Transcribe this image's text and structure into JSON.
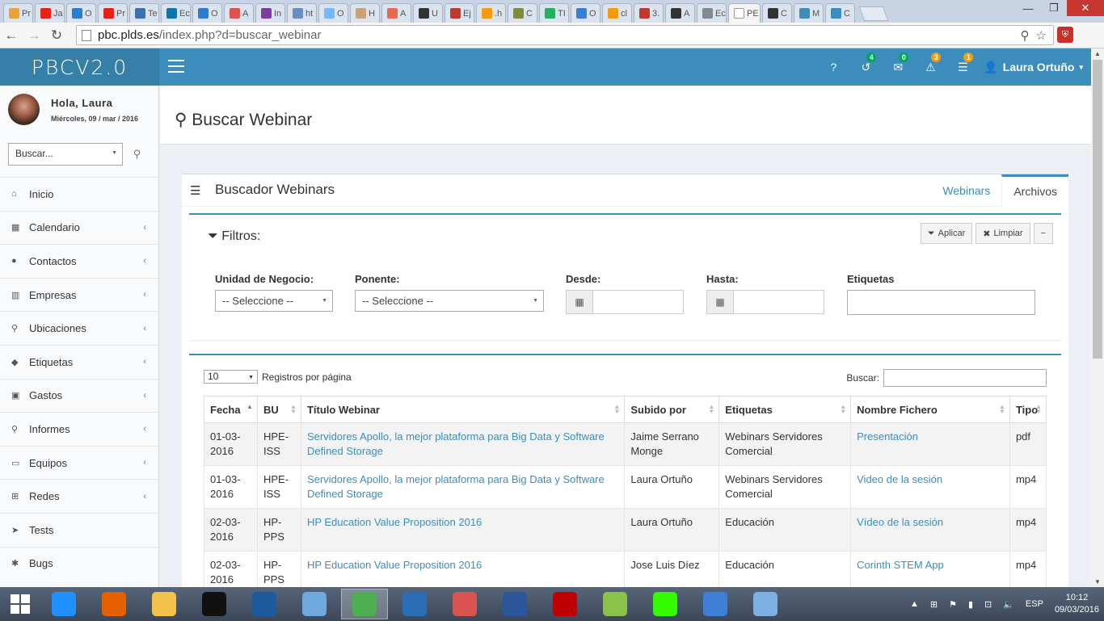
{
  "browser": {
    "tabs": [
      {
        "label": "Pr",
        "color": "#e8a23c"
      },
      {
        "label": "Ja",
        "color": "#e62117"
      },
      {
        "label": "O",
        "color": "#2b7cd3"
      },
      {
        "label": "Pr",
        "color": "#e62117"
      },
      {
        "label": "Te",
        "color": "#3b6fb6"
      },
      {
        "label": "Ec",
        "color": "#0e76a8"
      },
      {
        "label": "O",
        "color": "#2b7cd3"
      },
      {
        "label": "A",
        "color": "#d9534f"
      },
      {
        "label": "In",
        "color": "#7b3e9b"
      },
      {
        "label": "ht",
        "color": "#6c8ebf"
      },
      {
        "label": "O",
        "color": "#74b9ff"
      },
      {
        "label": "H",
        "color": "#c7a27a"
      },
      {
        "label": "A",
        "color": "#e86a4e"
      },
      {
        "label": "U",
        "color": "#333333"
      },
      {
        "label": "Ej",
        "color": "#c0392b"
      },
      {
        "label": ".h",
        "color": "#f39c12"
      },
      {
        "label": "C",
        "color": "#7f8c3c"
      },
      {
        "label": "TI",
        "color": "#27ae60"
      },
      {
        "label": "O",
        "color": "#3b7dd8"
      },
      {
        "label": "cl",
        "color": "#f39c12"
      },
      {
        "label": "3.",
        "color": "#c0392b"
      },
      {
        "label": "A",
        "color": "#333333"
      },
      {
        "label": "Ec",
        "color": "#7f8c8d"
      },
      {
        "label": "PE",
        "color": "#ffffff",
        "active": true
      },
      {
        "label": "C",
        "color": "#333333"
      },
      {
        "label": "M",
        "color": "#3c8dbc"
      },
      {
        "label": "C",
        "color": "#3c8dbc"
      }
    ],
    "url_host": "pbc.plds.es",
    "url_path": "/index.php?d=buscar_webinar"
  },
  "header": {
    "logo": "PBCV2.0",
    "icons": [
      {
        "name": "help-icon",
        "glyph": "?",
        "badge": "",
        "badge_color": ""
      },
      {
        "name": "history-icon",
        "glyph": "↺",
        "badge": "4",
        "badge_color": "#00a65a"
      },
      {
        "name": "mail-icon",
        "glyph": "✉",
        "badge": "0",
        "badge_color": "#00a65a"
      },
      {
        "name": "alert-icon",
        "glyph": "⚠",
        "badge": "3",
        "badge_color": "#f39c12"
      },
      {
        "name": "tasks-icon",
        "glyph": "☰",
        "badge": "1",
        "badge_color": "#f39c12"
      }
    ],
    "user_name": "Laura Ortuño"
  },
  "sidebar": {
    "greeting": "Hola, Laura",
    "date": "Miércoles, 09 / mar / 2016",
    "search_placeholder": "Buscar...",
    "items": [
      {
        "label": "Inicio",
        "icon": "home-icon",
        "glyph": "⌂",
        "chevron": false
      },
      {
        "label": "Calendario",
        "icon": "calendar-icon",
        "glyph": "▦",
        "chevron": true
      },
      {
        "label": "Contactos",
        "icon": "user-icon",
        "glyph": "●",
        "chevron": true
      },
      {
        "label": "Empresas",
        "icon": "building-icon",
        "glyph": "▥",
        "chevron": true
      },
      {
        "label": "Ubicaciones",
        "icon": "map-marker-icon",
        "glyph": "⚲",
        "chevron": true
      },
      {
        "label": "Etiquetas",
        "icon": "tags-icon",
        "glyph": "◆",
        "chevron": true
      },
      {
        "label": "Gastos",
        "icon": "money-icon",
        "glyph": "▣",
        "chevron": true
      },
      {
        "label": "Informes",
        "icon": "search-icon",
        "glyph": "⚲",
        "chevron": true
      },
      {
        "label": "Equipos",
        "icon": "desktop-icon",
        "glyph": "▭",
        "chevron": true
      },
      {
        "label": "Redes",
        "icon": "sitemap-icon",
        "glyph": "⊞",
        "chevron": true
      },
      {
        "label": "Tests",
        "icon": "paper-plane-icon",
        "glyph": "➤",
        "chevron": false
      },
      {
        "label": "Bugs",
        "icon": "bug-icon",
        "glyph": "✱",
        "chevron": false
      }
    ]
  },
  "page": {
    "title": "Buscar Webinar",
    "box_title": "Buscador Webinars",
    "tabs": [
      "Webinars",
      "Archivos"
    ],
    "active_tab": "Archivos"
  },
  "filters": {
    "title": "Filtros:",
    "apply_label": "Aplicar",
    "clear_label": "Limpiar",
    "collapse_label": "−",
    "unidad_label": "Unidad de Negocio:",
    "unidad_value": "-- Seleccione --",
    "ponente_label": "Ponente:",
    "ponente_value": "-- Seleccione --",
    "desde_label": "Desde:",
    "hasta_label": "Hasta:",
    "etiquetas_label": "Etiquetas"
  },
  "table": {
    "page_length": "10",
    "page_length_label": "Registros por página",
    "search_label": "Buscar:",
    "columns": [
      "Fecha",
      "BU",
      "Título Webinar",
      "Subido por",
      "Etiquetas",
      "Nombre Fichero",
      "Tipo"
    ],
    "rows": [
      {
        "fecha": "01-03-2016",
        "bu": "HPE-ISS",
        "titulo": "Servidores Apollo, la mejor plataforma para Big Data y Software Defined Storage",
        "subido": "Jaime Serrano Monge",
        "etiquetas": "Webinars Servidores Comercial",
        "fichero": "Presentación",
        "tipo": "pdf"
      },
      {
        "fecha": "01-03-2016",
        "bu": "HPE-ISS",
        "titulo": "Servidores Apollo, la mejor plataforma para Big Data y Software Defined Storage",
        "subido": "Laura Ortuño",
        "etiquetas": "Webinars Servidores Comercial",
        "fichero": "Video de la sesión",
        "tipo": "mp4"
      },
      {
        "fecha": "02-03-2016",
        "bu": "HP-PPS",
        "titulo": "HP Education Value Proposition 2016",
        "subido": "Laura Ortuño",
        "etiquetas": "Educación",
        "fichero": "Vídeo de la sesión",
        "tipo": "mp4"
      },
      {
        "fecha": "02-03-2016",
        "bu": "HP-PPS",
        "titulo": "HP Education Value Proposition 2016",
        "subido": "Jose Luis Díez",
        "etiquetas": "Educación",
        "fichero": "Corinth STEM App",
        "tipo": "mp4"
      }
    ]
  },
  "taskbar": {
    "apps": [
      {
        "name": "internet-explorer-icon",
        "color": "#1e90ff"
      },
      {
        "name": "firefox-icon",
        "color": "#e66000"
      },
      {
        "name": "file-explorer-icon",
        "color": "#f3c24b"
      },
      {
        "name": "command-prompt-icon",
        "color": "#111111"
      },
      {
        "name": "virtualbox-icon",
        "color": "#1c5a9c"
      },
      {
        "name": "network-icon",
        "color": "#6fa8dc"
      },
      {
        "name": "chrome-icon",
        "color": "#4caf50",
        "active": true
      },
      {
        "name": "remote-desktop-icon",
        "color": "#2a6fb5"
      },
      {
        "name": "snipping-tool-icon",
        "color": "#d9534f"
      },
      {
        "name": "word-icon",
        "color": "#2b579a"
      },
      {
        "name": "filezilla-icon",
        "color": "#bf0000"
      },
      {
        "name": "notepadpp-icon",
        "color": "#8bc34a"
      },
      {
        "name": "dreamweaver-icon",
        "color": "#35fa00"
      },
      {
        "name": "snowflake-app-icon",
        "color": "#3f7fd8"
      },
      {
        "name": "paint-icon",
        "color": "#7bb0e0"
      }
    ],
    "language": "ESP",
    "time": "10:12",
    "date": "09/03/2016"
  }
}
